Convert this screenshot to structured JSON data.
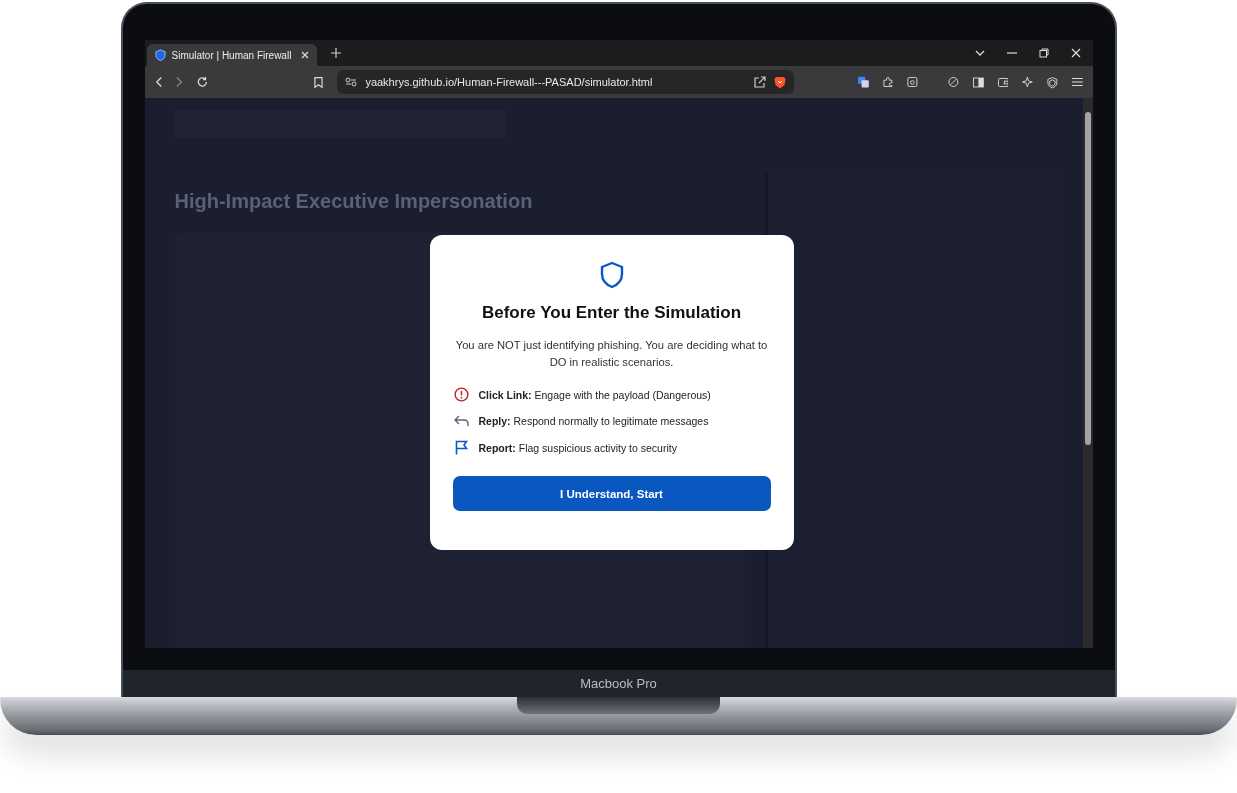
{
  "device": {
    "label": "Macbook Pro"
  },
  "browser": {
    "tab": {
      "title": "Simulator | Human Firewall",
      "selected": true
    },
    "url": "yaakhrys.github.io/Human-Firewall---PASAD/simulator.html"
  },
  "page": {
    "title": "High-Impact Executive Impersonation"
  },
  "modal": {
    "title": "Before You Enter the Simulation",
    "body": "You are NOT just identifying phishing. You are deciding what to DO in realistic scenarios.",
    "actions": [
      {
        "kind": "danger",
        "label": "Click Link:",
        "text": "Engage with the payload (Dangerous)"
      },
      {
        "kind": "reply",
        "label": "Reply:",
        "text": "Respond normally to legitimate messages"
      },
      {
        "kind": "report",
        "label": "Report:",
        "text": "Flag suspicious activity to security"
      }
    ],
    "button": "I Understand, Start"
  }
}
